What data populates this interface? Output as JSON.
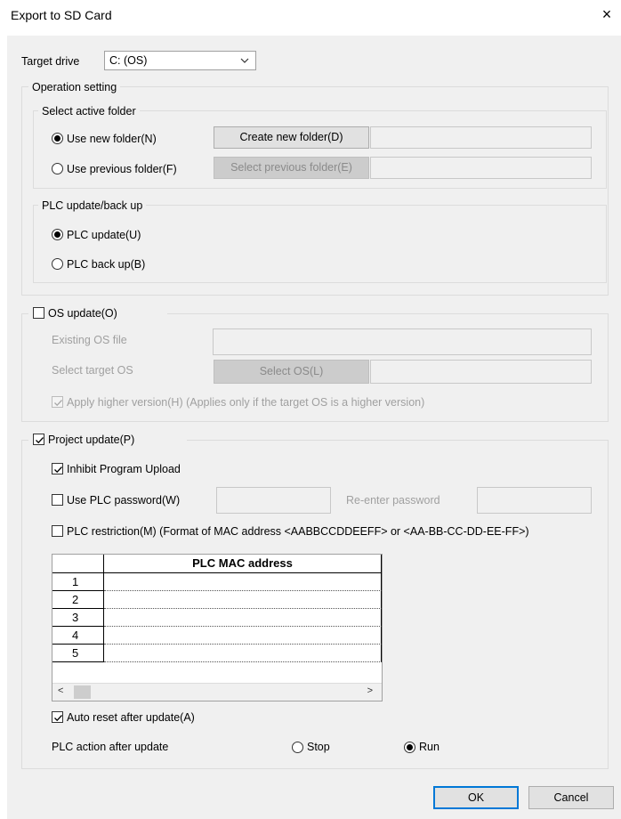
{
  "window": {
    "title": "Export to SD Card"
  },
  "target_drive": {
    "label": "Target drive",
    "value": "C: (OS)"
  },
  "operation_setting": {
    "title": "Operation setting",
    "select_active_folder": {
      "title": "Select active folder",
      "use_new_folder": "Use new folder(N)",
      "create_new_folder_button": "Create new folder(D)",
      "use_previous_folder": "Use previous folder(F)",
      "select_previous_folder_button": "Select previous folder(E)",
      "selected": "new"
    },
    "plc_update_backup": {
      "title": "PLC update/back up",
      "plc_update": "PLC update(U)",
      "plc_backup": "PLC back up(B)",
      "selected": "update"
    }
  },
  "os_update": {
    "label": "OS update(O)",
    "checked": false,
    "existing_os_file_label": "Existing OS file",
    "select_target_os_label": "Select target OS",
    "select_os_button": "Select OS(L)",
    "apply_higher_version": "Apply higher version(H) (Applies only if the target OS is a higher version)",
    "apply_higher_version_checked": true
  },
  "project_update": {
    "label": "Project update(P)",
    "checked": true,
    "inhibit_program_upload": "Inhibit Program Upload",
    "inhibit_checked": true,
    "use_plc_password": "Use PLC password(W)",
    "use_plc_password_checked": false,
    "reenter_password_label": "Re-enter password",
    "plc_restriction": "PLC restriction(M) (Format of MAC address <AABBCCDDEEFF> or <AA-BB-CC-DD-EE-FF>)",
    "plc_restriction_checked": false,
    "mac_table": {
      "header": "PLC MAC address",
      "rows": [
        "1",
        "2",
        "3",
        "4",
        "5"
      ]
    },
    "auto_reset": "Auto reset after update(A)",
    "auto_reset_checked": true,
    "plc_action_label": "PLC action after update",
    "stop_label": "Stop",
    "run_label": "Run",
    "selected_action": "run"
  },
  "buttons": {
    "ok": "OK",
    "cancel": "Cancel"
  },
  "scroll_glyphs": {
    "left": "<",
    "right": ">"
  },
  "icons": {
    "close": "×",
    "chevron": "⌵"
  }
}
